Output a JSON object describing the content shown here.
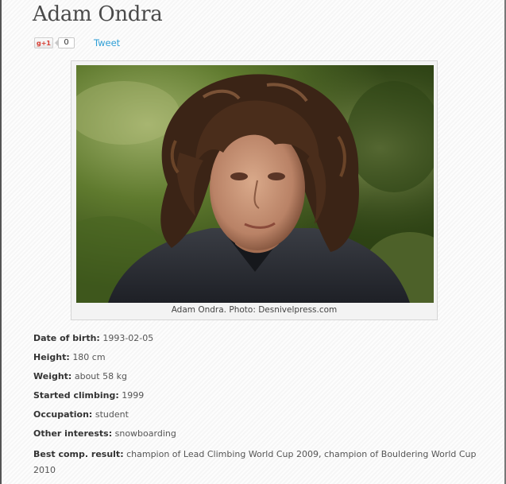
{
  "page": {
    "title": "Adam Ondra"
  },
  "social": {
    "gplus_label": "g+1",
    "gplus_count": "0",
    "tweet_label": "Tweet"
  },
  "photo": {
    "caption": "Adam Ondra. Photo: Desnivelpress.com"
  },
  "details": [
    {
      "label": "Date of birth:",
      "value": "1993-02-05"
    },
    {
      "label": "Height:",
      "value": "180 cm"
    },
    {
      "label": "Weight:",
      "value": "about 58 kg"
    },
    {
      "label": "Started climbing:",
      "value": "1999"
    },
    {
      "label": "Occupation:",
      "value": "student"
    },
    {
      "label": "Other interests:",
      "value": "snowboarding"
    },
    {
      "label": "Best comp. result:",
      "value": "champion of Lead Climbing World Cup 2009, champion of Bouldering World Cup 2010"
    }
  ],
  "colors": {
    "title": "#4a4a4a",
    "tweet_link": "#2f9fd6",
    "gplus_red": "#d73d32"
  }
}
